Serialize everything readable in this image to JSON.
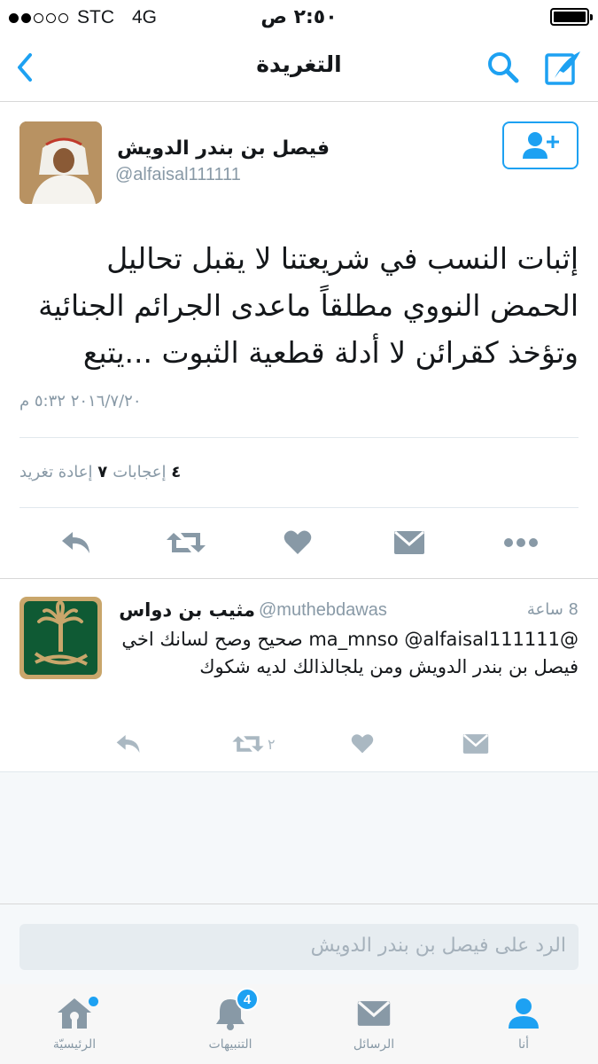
{
  "status_bar": {
    "carrier": "STC",
    "network": "4G",
    "time": "٢:٥٠ ص",
    "signal_bars_filled": 2,
    "signal_bars_total": 5
  },
  "nav": {
    "title": "التغريدة",
    "back_icon": "chevron-left-icon",
    "search_icon": "search-icon",
    "compose_icon": "compose-icon"
  },
  "tweet": {
    "author_name": "فيصل بن بندر الدويش",
    "author_handle": "@alfaisal111111",
    "text": "إثبات النسب في شريعتنا لا يقبل تحاليل الحمض النووي مطلقاً ماعدى الجرائم الجنائية وتؤخذ كقرائن لا أدلة قطعية الثبوت ...يتبع",
    "date": "٢٠١٦/٧/٢٠ ٥:٣٢ م",
    "retweets_count": "٧",
    "retweets_label": "إعادة تغريد",
    "likes_count": "٤",
    "likes_label": "إعجابات"
  },
  "reply": {
    "author_name": "مثيب بن دواس",
    "author_handle": "@muthebdawas",
    "time": "8 ساعة",
    "text": "@ma_mnso @alfaisal111111 صحيح وصح لسانك اخي فيصل بن بندر الدويش ومن يلجالذالك لديه شكوك",
    "retweet_count": "٢"
  },
  "reply_box": {
    "placeholder": "الرد على فيصل بن بندر الدويش"
  },
  "tabs": [
    {
      "label": "الرئيسيّة",
      "icon": "home-icon"
    },
    {
      "label": "التنبيهات",
      "icon": "bell-icon",
      "badge": "4"
    },
    {
      "label": "الرسائل",
      "icon": "mail-icon"
    },
    {
      "label": "أنا",
      "icon": "user-icon"
    }
  ],
  "colors": {
    "accent": "#1da1f2",
    "muted": "#8899a6",
    "icon_gray": "#aab8c2"
  }
}
